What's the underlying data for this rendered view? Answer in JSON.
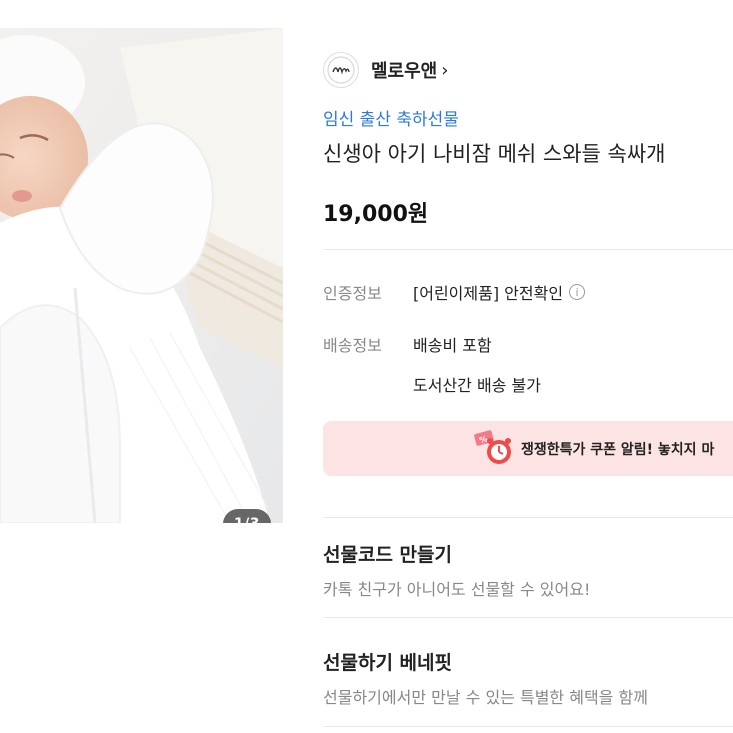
{
  "image": {
    "counter": "1/3",
    "photo_icon": "baby-swaddle-photo"
  },
  "store": {
    "logo_icon": "store-logo-icon",
    "name": "멜로우앤",
    "chevron": "›"
  },
  "product": {
    "category": "임신 출산 축하선물",
    "title": "신생아 아기 나비잠 메쉬 스와들 속싸개",
    "price": "19,000원"
  },
  "details": {
    "cert_label": "인증정보",
    "cert_value": "[어린이제품] 안전확인",
    "cert_info_icon": "i",
    "shipping_label": "배송정보",
    "shipping_value": "배송비 포함",
    "shipping_note": "도서산간 배송 불가"
  },
  "coupon": {
    "text": "쟁쟁한특가 쿠폰 알림! 놓치지 마",
    "icon": "alarm-clock-icon",
    "colors": {
      "background": "#fde4e4",
      "clock": "#f04a4a"
    }
  },
  "gift_code": {
    "title": "선물코드 만들기",
    "desc": "카톡 친구가 아니어도 선물할 수 있어요!"
  },
  "gift_benefit": {
    "title": "선물하기 베네핏",
    "desc": "선물하기에서만 만날 수 있는 특별한 혜택을 함께"
  },
  "colors": {
    "accent_blue": "#2b7bd8",
    "muted_text": "#888888",
    "divider": "#e9e9e9"
  }
}
